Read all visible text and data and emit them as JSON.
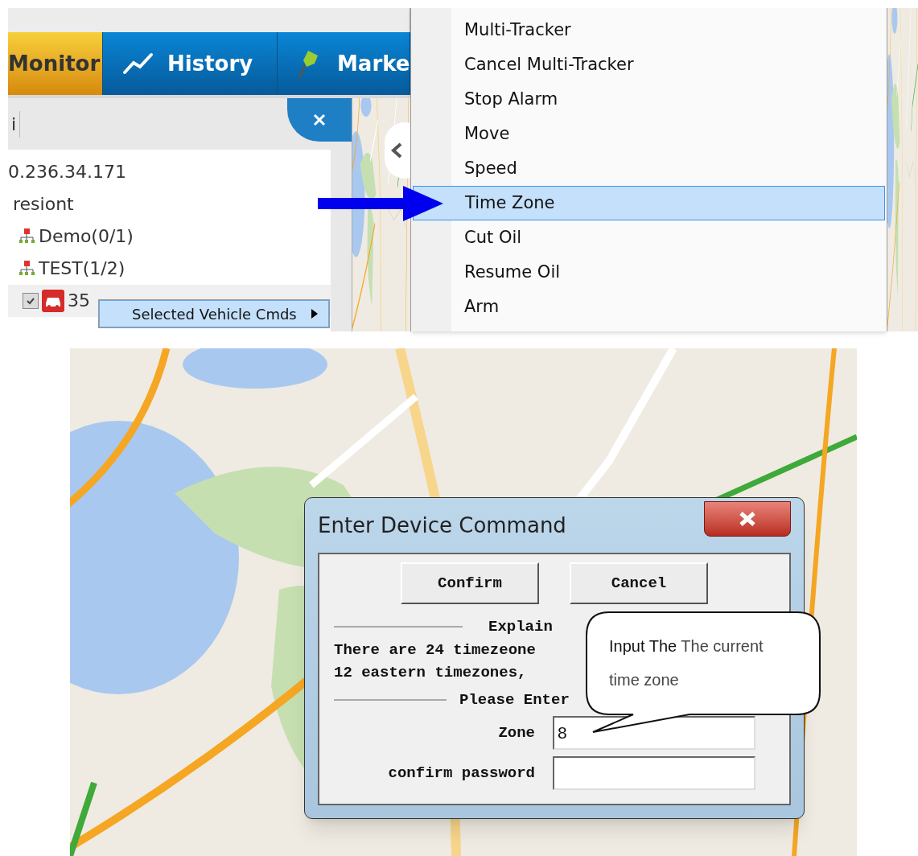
{
  "toolbar": {
    "tabs": [
      {
        "label": "Monitor",
        "selected": true
      },
      {
        "label": "History",
        "selected": false
      },
      {
        "label": "Marke",
        "selected": false
      }
    ]
  },
  "panel": {
    "tab_label": "i",
    "tree": [
      {
        "label": "0.236.34.171",
        "children": [
          {
            "label": "resiont",
            "children": [
              {
                "label": "Demo(0/1)",
                "kind": "group"
              },
              {
                "label": "TEST(1/2)",
                "kind": "group",
                "children": [
                  {
                    "label": "35",
                    "kind": "vehicle",
                    "checked": true
                  }
                ]
              }
            ]
          }
        ]
      }
    ]
  },
  "context_menu": {
    "items": [
      {
        "label": "Selected Vehicle Cmds",
        "selected": true
      }
    ]
  },
  "submenu": {
    "items": [
      {
        "label": "Multi-Tracker",
        "selected": false
      },
      {
        "label": "Cancel Multi-Tracker",
        "selected": false
      },
      {
        "label": "Stop Alarm",
        "selected": false
      },
      {
        "label": "Move",
        "selected": false
      },
      {
        "label": "Speed",
        "selected": false
      },
      {
        "label": "Time Zone",
        "selected": true
      },
      {
        "label": "Cut Oil",
        "selected": false
      },
      {
        "label": "Resume Oil",
        "selected": false
      },
      {
        "label": "Arm",
        "selected": false
      }
    ]
  },
  "dialog": {
    "title": "Enter Device Command",
    "buttons": [
      "Confirm",
      "Cancel"
    ],
    "explain_heading": "Explain",
    "explain_lines": [
      "There are 24 timezeone",
      "12 eastern timezones,"
    ],
    "enter_heading": "Please Enter",
    "fields": [
      {
        "label": "Zone",
        "value": "8"
      },
      {
        "label": "confirm password"
      }
    ]
  },
  "callout": {
    "emphasis": "Input The",
    "rest": "The current time zone"
  }
}
